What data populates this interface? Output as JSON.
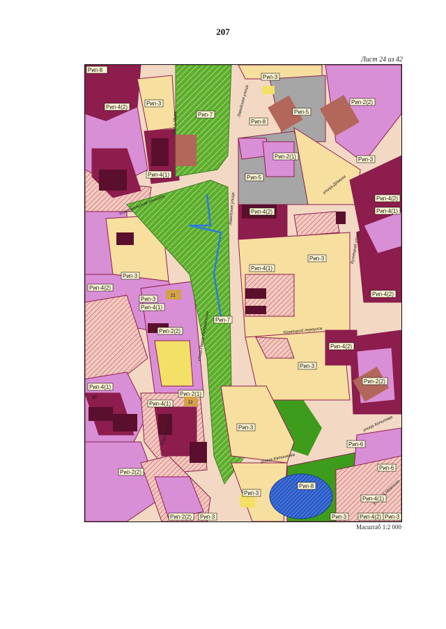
{
  "page": {
    "number": "207",
    "sheet": "Лист 24 из 42",
    "scale": "Масштаб 1:2 000"
  },
  "colors": {
    "residential_low": "#f7dfa0",
    "mixed": "#d98fd6",
    "high": "#8c1d4d",
    "green": "#5cae2c",
    "road": "#f3d9c4",
    "industrial": "#a6a6a6",
    "water": "#2a5bc8"
  },
  "zones": [
    {
      "id": "z1",
      "label": "Рип-8"
    },
    {
      "id": "z2",
      "label": "Рип-4(2)"
    },
    {
      "id": "z3",
      "label": "Рип-3"
    },
    {
      "id": "z4",
      "label": "Рип-7"
    },
    {
      "id": "z5",
      "label": "Рип-3"
    },
    {
      "id": "z6",
      "label": "Рип-2(2)"
    },
    {
      "id": "z7",
      "label": "Рип-5"
    },
    {
      "id": "z8",
      "label": "Рип-8"
    },
    {
      "id": "z9",
      "label": "Рип-2(1)"
    },
    {
      "id": "z10",
      "label": "Рип-3"
    },
    {
      "id": "z11",
      "label": "Рип-4(1)"
    },
    {
      "id": "z12",
      "label": "Рип-5"
    },
    {
      "id": "z13",
      "label": "Рип-4(2)"
    },
    {
      "id": "z14",
      "label": "Рип-4(2)"
    },
    {
      "id": "z15",
      "label": "Рип-4(1)"
    },
    {
      "id": "z16",
      "label": "Рип-3"
    },
    {
      "id": "z17",
      "label": "Рип-4(1)"
    },
    {
      "id": "z18",
      "label": "Рип-3"
    },
    {
      "id": "z19",
      "label": "Рип-4(2)"
    },
    {
      "id": "z20",
      "label": "Рип-4(2)"
    },
    {
      "id": "z21",
      "label": "Рип-3"
    },
    {
      "id": "z22",
      "label": "Рип-4(1)"
    },
    {
      "id": "z23",
      "label": "Рип-7"
    },
    {
      "id": "z24",
      "label": "Рип-2(2)"
    },
    {
      "id": "z25",
      "label": "Рип-4(2)"
    },
    {
      "id": "z26",
      "label": "Рип-3"
    },
    {
      "id": "z27",
      "label": "Рип-2(2)"
    },
    {
      "id": "z28",
      "label": "Рип-4(1)"
    },
    {
      "id": "z29",
      "label": "Рип-2(1)"
    },
    {
      "id": "z30",
      "label": "Рип-4(1)"
    },
    {
      "id": "z31",
      "label": "Рип-3"
    },
    {
      "id": "z32",
      "label": "Рип-6"
    },
    {
      "id": "z33",
      "label": "Рип-6"
    },
    {
      "id": "z34",
      "label": "Рип-2(2)"
    },
    {
      "id": "z35",
      "label": "Рип-8"
    },
    {
      "id": "z36",
      "label": "Рип-3"
    },
    {
      "id": "z37",
      "label": "Рип-4(1)"
    },
    {
      "id": "z38",
      "label": "Рип-2(2)"
    },
    {
      "id": "z39",
      "label": "Рип-3"
    },
    {
      "id": "z40",
      "label": "Рип-3"
    },
    {
      "id": "z41",
      "label": "Рип-4(2)"
    },
    {
      "id": "z42",
      "label": "Рип-3"
    }
  ],
  "streets": [
    {
      "id": "s1",
      "label": "улица Мира"
    },
    {
      "id": "s2",
      "label": "Заводская улица"
    },
    {
      "id": "s3",
      "label": "улица Дёмина"
    },
    {
      "id": "s4",
      "label": "Комсомольская площадь"
    },
    {
      "id": "s5",
      "label": "Заводская улица"
    },
    {
      "id": "s6",
      "label": "Кузнецкая улица"
    },
    {
      "id": "s7",
      "label": "Кузнецкий переулок"
    },
    {
      "id": "s8",
      "label": "улица Павла Покровского"
    },
    {
      "id": "s9",
      "label": "Красная улица"
    },
    {
      "id": "s10",
      "label": "улица Катинкова"
    },
    {
      "id": "s11",
      "label": "улица Копылова"
    },
    {
      "id": "s12",
      "label": "улица А.Невского"
    }
  ],
  "numbers": [
    {
      "id": "n1",
      "label": "21"
    },
    {
      "id": "n2",
      "label": "22"
    },
    {
      "id": "n3",
      "label": "30"
    }
  ]
}
